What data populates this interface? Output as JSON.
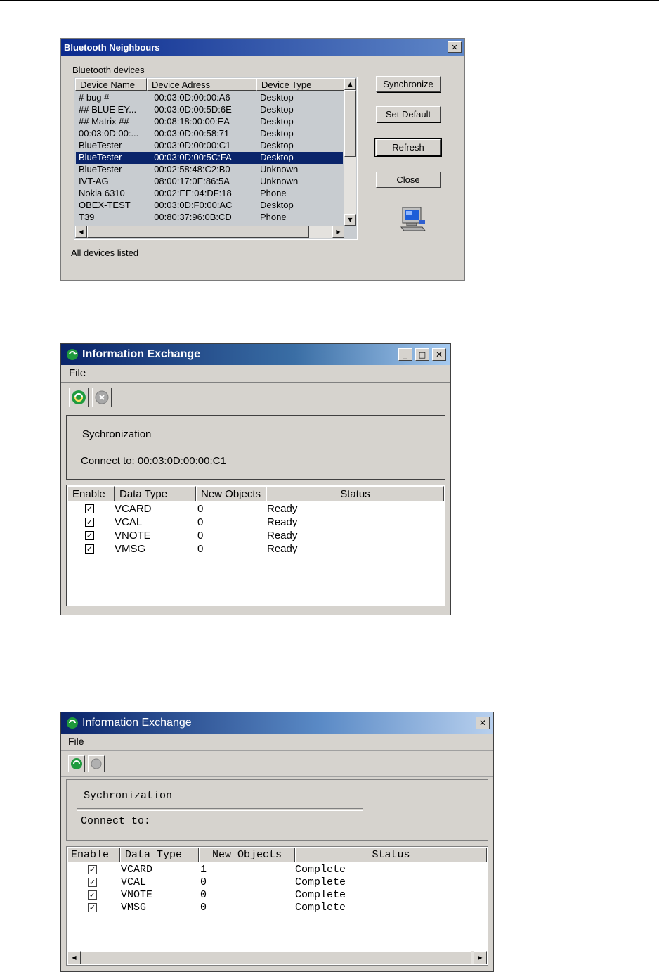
{
  "window1": {
    "title": "Bluetooth Neighbours",
    "group_label": "Bluetooth devices",
    "columns": [
      "Device Name",
      "Device Adress",
      "Device Type"
    ],
    "rows": [
      [
        "# bug #",
        "00:03:0D:00:00:A6",
        "Desktop"
      ],
      [
        "## BLUE EY...",
        "00:03:0D:00:5D:6E",
        "Desktop"
      ],
      [
        "## Matrix ##",
        "00:08:18:00:00:EA",
        "Desktop"
      ],
      [
        "00:03:0D:00:...",
        "00:03:0D:00:58:71",
        "Desktop"
      ],
      [
        "BlueTester",
        "00:03:0D:00:00:C1",
        "Desktop"
      ],
      [
        "BlueTester",
        "00:03:0D:00:5C:FA",
        "Desktop"
      ],
      [
        "BlueTester",
        "00:02:58:48:C2:B0",
        "Unknown"
      ],
      [
        "IVT-AG",
        "08:00:17:0E:86:5A",
        "Unknown"
      ],
      [
        "Nokia 6310",
        "00:02:EE:04:DF:18",
        "Phone"
      ],
      [
        "OBEX-TEST",
        "00:03:0D:F0:00:AC",
        "Desktop"
      ],
      [
        "T39",
        "00:80:37:96:0B:CD",
        "Phone"
      ]
    ],
    "selected_row": 5,
    "buttons": {
      "synchronize": "Synchronize",
      "set_default": "Set Default",
      "refresh": "Refresh",
      "close": "Close"
    },
    "status": "All devices listed",
    "close_glyph": "✕"
  },
  "window2": {
    "title": "Information Exchange",
    "menu": {
      "file": "File"
    },
    "group_title": "Sychronization",
    "connect_text": "Connect to: 00:03:0D:00:00:C1",
    "columns": [
      "Enable",
      "Data Type",
      "New Objects",
      "Status"
    ],
    "rows": [
      {
        "checked": true,
        "type": "VCARD",
        "count": "0",
        "status": "Ready"
      },
      {
        "checked": true,
        "type": "VCAL",
        "count": "0",
        "status": "Ready"
      },
      {
        "checked": true,
        "type": "VNOTE",
        "count": "0",
        "status": "Ready"
      },
      {
        "checked": true,
        "type": "VMSG",
        "count": "0",
        "status": "Ready"
      }
    ],
    "check_glyph": "✓"
  },
  "window3": {
    "title": "Information Exchange",
    "menu": {
      "file": "File"
    },
    "group_title": "Sychronization",
    "connect_text": "Connect to:",
    "columns": [
      "Enable",
      "Data Type",
      "New Objects",
      "Status"
    ],
    "rows": [
      {
        "checked": true,
        "type": "VCARD",
        "count": "1",
        "status": "Complete"
      },
      {
        "checked": true,
        "type": "VCAL",
        "count": "0",
        "status": "Complete"
      },
      {
        "checked": true,
        "type": "VNOTE",
        "count": "0",
        "status": "Complete"
      },
      {
        "checked": true,
        "type": "VMSG",
        "count": "0",
        "status": "Complete"
      }
    ]
  }
}
